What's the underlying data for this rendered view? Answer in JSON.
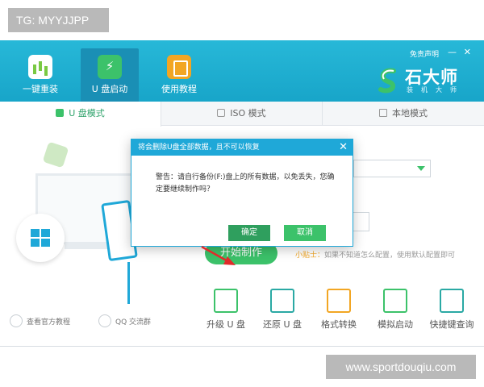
{
  "watermark": {
    "tg": "TG: MYYJJPP",
    "site": "www.sportdouqiu.com"
  },
  "header": {
    "nav": [
      {
        "label": "一键重装",
        "icon": "chart-icon"
      },
      {
        "label": "U 盘启动",
        "icon": "usb-icon",
        "active": true
      },
      {
        "label": "使用教程",
        "icon": "book-icon"
      }
    ],
    "free_notice": "免责声明",
    "window_controls": {
      "minimize": "—",
      "close": "✕"
    },
    "brand": {
      "name": "石大师",
      "subtitle": "装机大师"
    }
  },
  "tabs": [
    {
      "label": "U 盘模式",
      "icon": "usb-icon",
      "active": true
    },
    {
      "label": "ISO 模式",
      "icon": "disc-icon"
    },
    {
      "label": "本地模式",
      "icon": "monitor-icon"
    }
  ],
  "main": {
    "start_button": "开始制作",
    "tip_title": "小贴士：",
    "tip_text": "如果不知道怎么配置，使用默认配置即可"
  },
  "tools": [
    {
      "label": "升级 U 盘",
      "icon": "upgrade-usb-icon"
    },
    {
      "label": "还原 U 盘",
      "icon": "restore-usb-icon"
    },
    {
      "label": "格式转换",
      "icon": "format-convert-icon"
    },
    {
      "label": "模拟启动",
      "icon": "simulate-boot-icon"
    },
    {
      "label": "快捷键查询",
      "icon": "shortcut-query-icon"
    }
  ],
  "links": [
    {
      "label": "查看官方教程",
      "icon": "tutorial-icon"
    },
    {
      "label": "QQ 交流群",
      "icon": "qq-group-icon"
    }
  ],
  "modal": {
    "title": "将会删除U盘全部数据，且不可以恢复",
    "close_glyph": "✕",
    "message": "警告：请自行备份(F:)盘上的所有数据，以免丢失，您确定要继续制作吗？",
    "ok_label": "确定",
    "cancel_label": "取消"
  },
  "colors": {
    "header": "#1fa8d8",
    "accent_green": "#3cc26a",
    "ok_green": "#2f9f5e",
    "arrow_red": "#e02b2b",
    "tip_orange": "#f2a623"
  }
}
